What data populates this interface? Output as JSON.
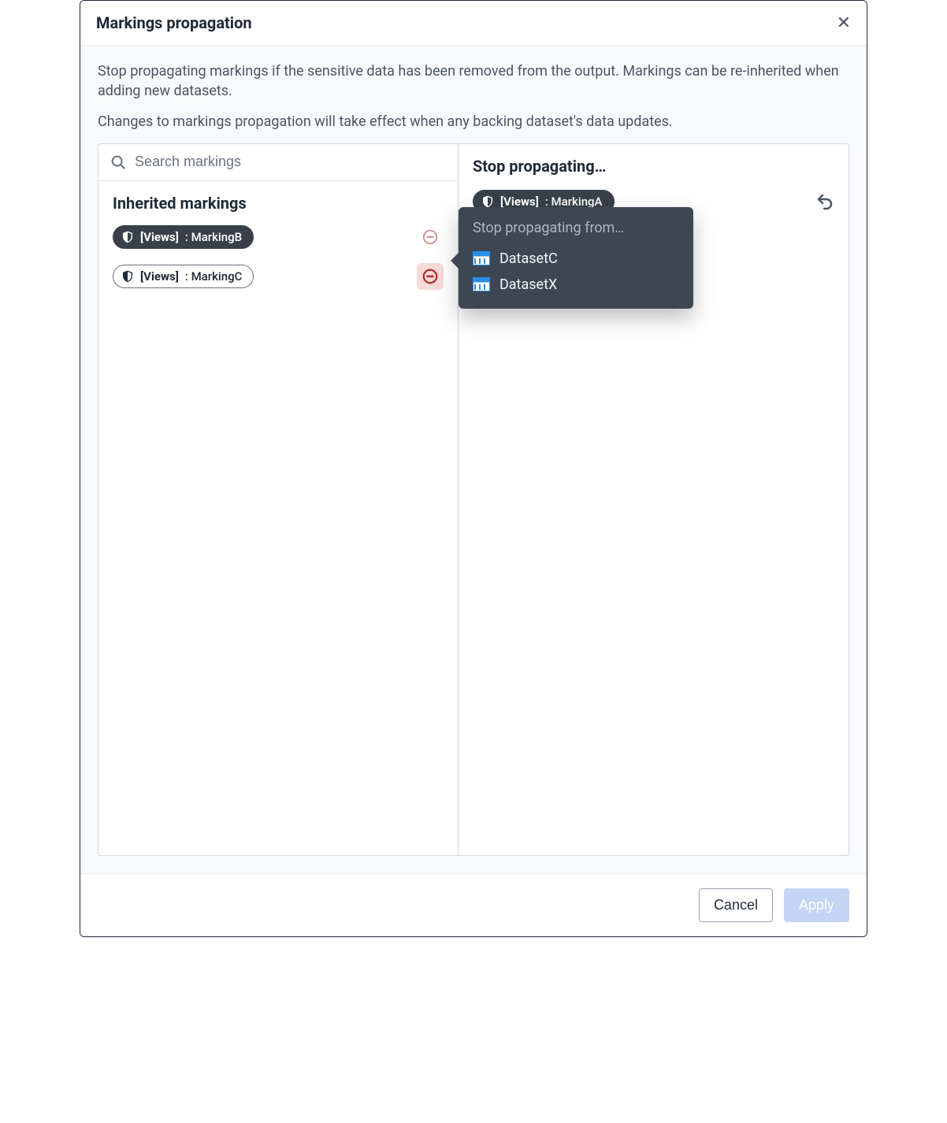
{
  "dialog": {
    "title": "Markings propagation",
    "description1": "Stop propagating markings if the sensitive data has been removed from the output. Markings can be re-inherited when adding new datasets.",
    "description2": "Changes to markings propagation will take effect when any backing dataset's data updates."
  },
  "search": {
    "placeholder": "Search markings"
  },
  "left": {
    "section_title": "Inherited markings",
    "items": [
      {
        "prefix": "[Views]",
        "label": ": MarkingB",
        "style": "dark",
        "active": false
      },
      {
        "prefix": "[Views]",
        "label": ": MarkingC",
        "style": "light",
        "active": true
      }
    ]
  },
  "right": {
    "title": "Stop propagating…",
    "chip": {
      "prefix": "[Views]",
      "label": ": MarkingA"
    }
  },
  "popover": {
    "title": "Stop propagating from…",
    "datasets": [
      "DatasetC",
      "DatasetX"
    ]
  },
  "footer": {
    "cancel": "Cancel",
    "apply": "Apply"
  }
}
